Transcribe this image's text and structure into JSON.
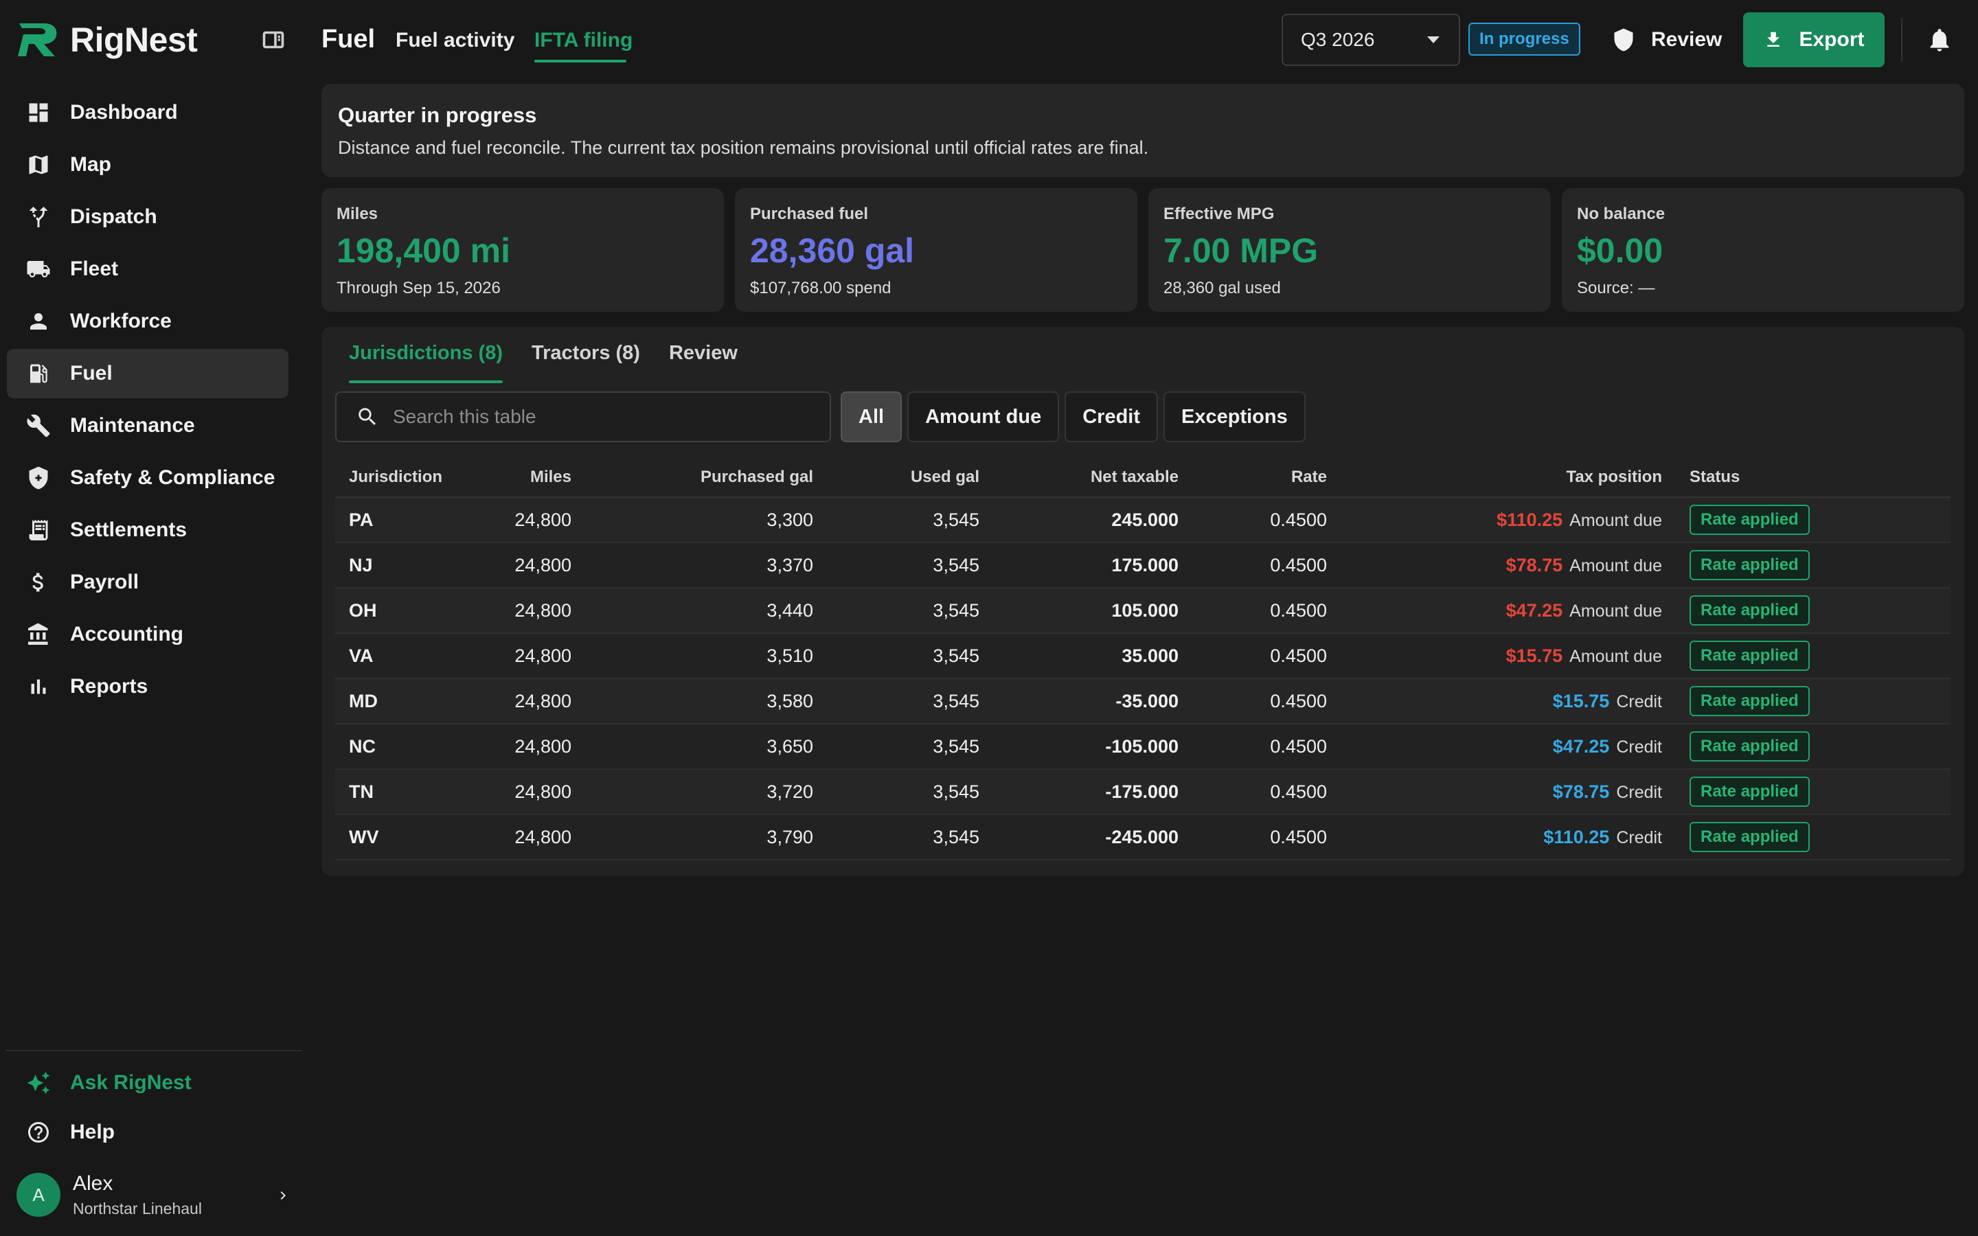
{
  "app": {
    "logo_text": "RigNest",
    "brand_color": "#1fa26b"
  },
  "sidebar": {
    "items": [
      {
        "label": "Dashboard",
        "icon": "dashboard-icon"
      },
      {
        "label": "Map",
        "icon": "map-icon"
      },
      {
        "label": "Dispatch",
        "icon": "dispatch-icon"
      },
      {
        "label": "Fleet",
        "icon": "truck-icon"
      },
      {
        "label": "Workforce",
        "icon": "person-icon"
      },
      {
        "label": "Fuel",
        "icon": "fuel-pump-icon",
        "active": true
      },
      {
        "label": "Maintenance",
        "icon": "wrench-icon"
      },
      {
        "label": "Safety & Compliance",
        "icon": "shield-icon"
      },
      {
        "label": "Settlements",
        "icon": "receipt-icon"
      },
      {
        "label": "Payroll",
        "icon": "dollar-icon"
      },
      {
        "label": "Accounting",
        "icon": "bank-icon"
      },
      {
        "label": "Reports",
        "icon": "bar-chart-icon"
      }
    ],
    "ask_label": "Ask RigNest",
    "help_label": "Help",
    "user": {
      "initial": "A",
      "name": "Alex",
      "org": "Northstar Linehaul"
    }
  },
  "topbar": {
    "title": "Fuel",
    "tabs": [
      {
        "label": "Fuel activity"
      },
      {
        "label": "IFTA filing",
        "active": true
      }
    ],
    "quarter": "Q3 2026",
    "status": "In progress",
    "review_label": "Review",
    "export_label": "Export"
  },
  "banner": {
    "title": "Quarter in progress",
    "text": "Distance and fuel reconcile. The current tax position remains provisional until official rates are final."
  },
  "kpis": [
    {
      "label": "Miles",
      "value": "198,400 mi",
      "sub": "Through Sep 15, 2026",
      "color": "#1fa26b"
    },
    {
      "label": "Purchased fuel",
      "value": "28,360 gal",
      "sub": "$107,768.00 spend",
      "color": "#6c74ea"
    },
    {
      "label": "Effective MPG",
      "value": "7.00 MPG",
      "sub": "28,360 gal used",
      "color": "#1fa26b"
    },
    {
      "label": "No balance",
      "value": "$0.00",
      "sub": "Source: —",
      "color": "#1fa26b"
    }
  ],
  "table_card": {
    "tabs": [
      {
        "label": "Jurisdictions (8)",
        "active": true
      },
      {
        "label": "Tractors (8)"
      },
      {
        "label": "Review"
      }
    ],
    "search_placeholder": "Search this table",
    "filters": [
      {
        "label": "All",
        "active": true
      },
      {
        "label": "Amount due"
      },
      {
        "label": "Credit"
      },
      {
        "label": "Exceptions"
      }
    ],
    "columns": [
      "Jurisdiction",
      "Miles",
      "Purchased gal",
      "Used gal",
      "Net taxable",
      "Rate",
      "Tax position",
      "Status"
    ],
    "rows": [
      {
        "jurisdiction": "PA",
        "miles": "24,800",
        "purchased": "3,300",
        "used": "3,545",
        "net": "245.000",
        "rate": "0.4500",
        "amount": "$110.25",
        "position": "Amount due",
        "kind": "due",
        "status": "Rate applied"
      },
      {
        "jurisdiction": "NJ",
        "miles": "24,800",
        "purchased": "3,370",
        "used": "3,545",
        "net": "175.000",
        "rate": "0.4500",
        "amount": "$78.75",
        "position": "Amount due",
        "kind": "due",
        "status": "Rate applied"
      },
      {
        "jurisdiction": "OH",
        "miles": "24,800",
        "purchased": "3,440",
        "used": "3,545",
        "net": "105.000",
        "rate": "0.4500",
        "amount": "$47.25",
        "position": "Amount due",
        "kind": "due",
        "status": "Rate applied"
      },
      {
        "jurisdiction": "VA",
        "miles": "24,800",
        "purchased": "3,510",
        "used": "3,545",
        "net": "35.000",
        "rate": "0.4500",
        "amount": "$15.75",
        "position": "Amount due",
        "kind": "due",
        "status": "Rate applied"
      },
      {
        "jurisdiction": "MD",
        "miles": "24,800",
        "purchased": "3,580",
        "used": "3,545",
        "net": "-35.000",
        "rate": "0.4500",
        "amount": "$15.75",
        "position": "Credit",
        "kind": "credit",
        "status": "Rate applied"
      },
      {
        "jurisdiction": "NC",
        "miles": "24,800",
        "purchased": "3,650",
        "used": "3,545",
        "net": "-105.000",
        "rate": "0.4500",
        "amount": "$47.25",
        "position": "Credit",
        "kind": "credit",
        "status": "Rate applied"
      },
      {
        "jurisdiction": "TN",
        "miles": "24,800",
        "purchased": "3,720",
        "used": "3,545",
        "net": "-175.000",
        "rate": "0.4500",
        "amount": "$78.75",
        "position": "Credit",
        "kind": "credit",
        "status": "Rate applied"
      },
      {
        "jurisdiction": "WV",
        "miles": "24,800",
        "purchased": "3,790",
        "used": "3,545",
        "net": "-245.000",
        "rate": "0.4500",
        "amount": "$110.25",
        "position": "Credit",
        "kind": "credit",
        "status": "Rate applied"
      }
    ]
  }
}
